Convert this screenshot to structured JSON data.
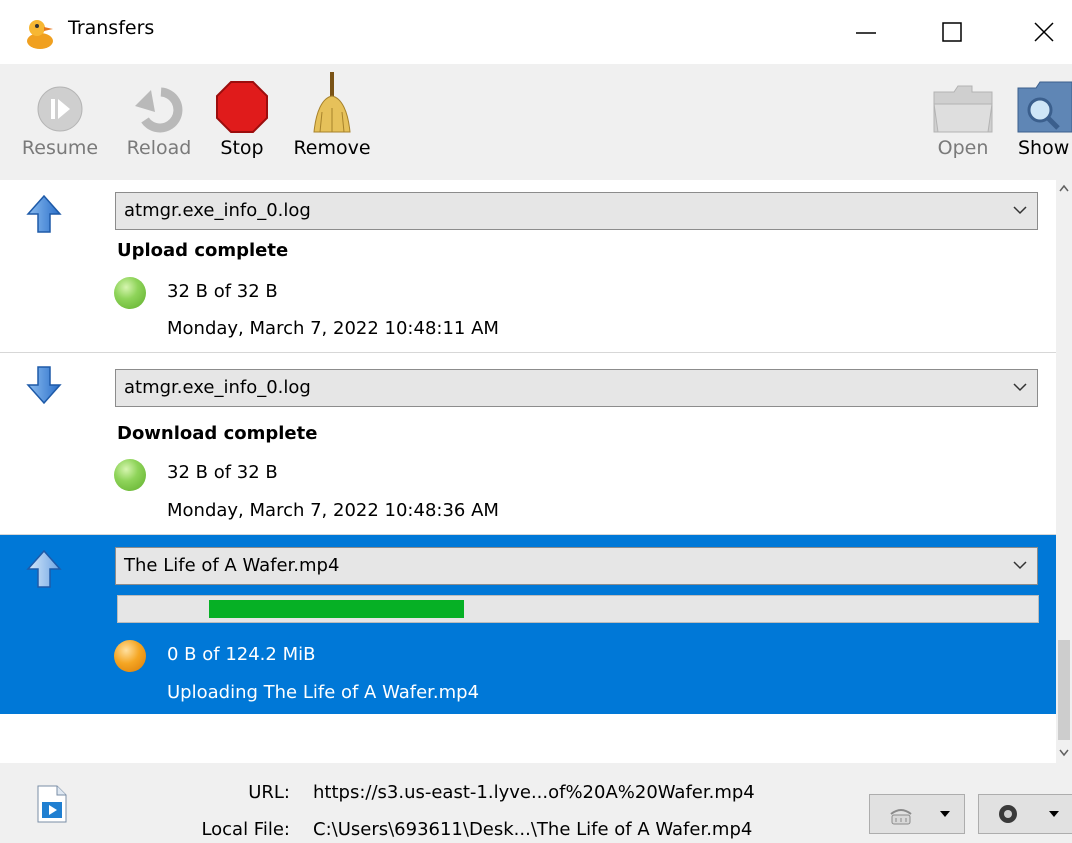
{
  "window": {
    "title": "Transfers",
    "controls": [
      "minimize",
      "maximize",
      "close"
    ]
  },
  "toolbar": {
    "left": [
      {
        "label": "Resume",
        "icon": "resume-icon",
        "enabled": false
      },
      {
        "label": "Reload",
        "icon": "reload-icon",
        "enabled": false
      },
      {
        "label": "Stop",
        "icon": "stop-icon",
        "enabled": true
      },
      {
        "label": "Remove",
        "icon": "broom-icon",
        "enabled": true
      }
    ],
    "right": [
      {
        "label": "Open",
        "icon": "folder-open-icon",
        "enabled": false
      },
      {
        "label": "Show",
        "icon": "folder-search-icon",
        "enabled": true
      }
    ]
  },
  "transfers": [
    {
      "direction": "upload",
      "file": "atmgr.exe_info_0.log",
      "status": "Upload complete",
      "size": "32 B of 32 B",
      "time": "Monday, March 7, 2022 10:48:11 AM",
      "state_color": "#7ccf49"
    },
    {
      "direction": "download",
      "file": "atmgr.exe_info_0.log",
      "status": "Download complete",
      "size": "32 B of 32 B",
      "time": "Monday, March 7, 2022 10:48:36 AM",
      "state_color": "#7ccf49"
    },
    {
      "direction": "upload",
      "file": "The Life of A Wafer.mp4",
      "selected": true,
      "progress": "indeterminate",
      "size": "0 B of 124.2 MiB",
      "detail": "Uploading The Life of A Wafer.mp4",
      "state_color": "#f5a623"
    }
  ],
  "footer": {
    "url_label": "URL:",
    "url_value": "https://s3.us-east-1.lyve...of%20A%20Wafer.mp4",
    "local_label": "Local File:",
    "local_value": "C:\\Users\\693611\\Desk...\\The Life of A Wafer.mp4",
    "buttons": [
      "bandwidth-icon",
      "connections-icon"
    ]
  },
  "colors": {
    "selection": "#0078d7",
    "progress_fill": "#06b025"
  }
}
